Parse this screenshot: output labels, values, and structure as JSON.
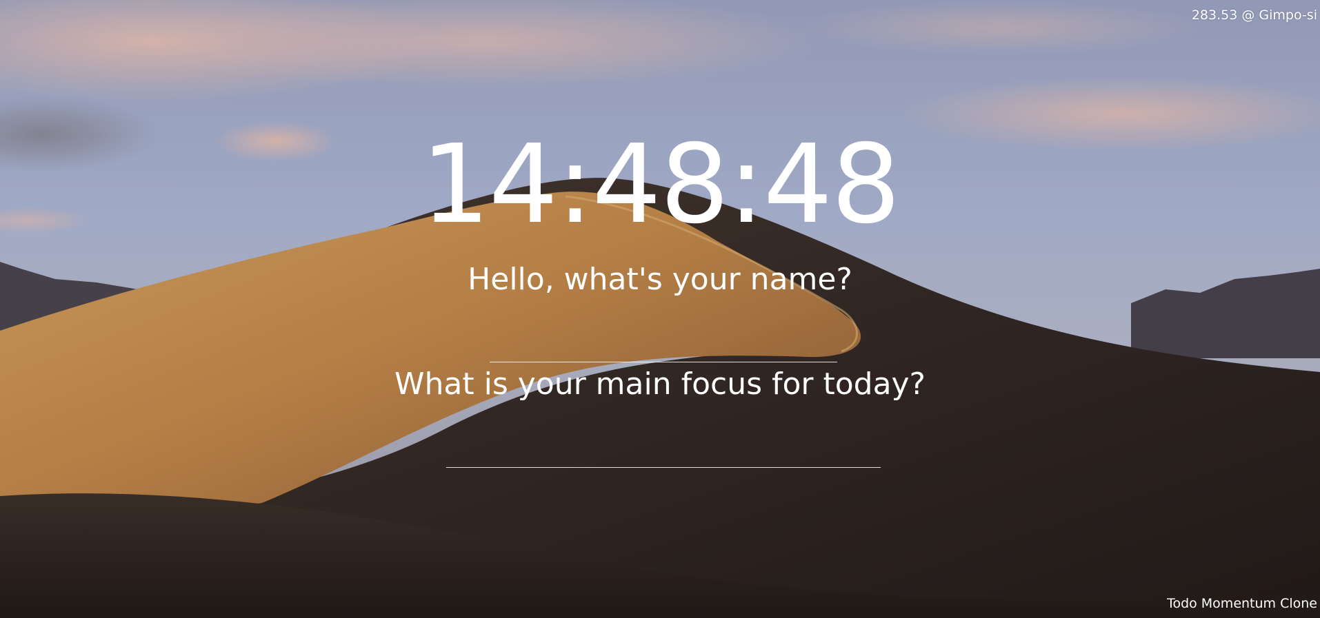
{
  "weather": {
    "text": "283.53 @ Gimpo-si"
  },
  "clock": {
    "time": "14:48:48"
  },
  "greeting": {
    "label": "Hello, what's your name?",
    "input_value": ""
  },
  "focus": {
    "label": "What is your main focus for today?",
    "input_value": ""
  },
  "footer": {
    "text": "Todo Momentum Clone"
  },
  "colors": {
    "text": "#ffffff",
    "sky_top": "#a9b3d0",
    "dune_light": "#c99353",
    "dune_shadow": "#2f2622"
  }
}
